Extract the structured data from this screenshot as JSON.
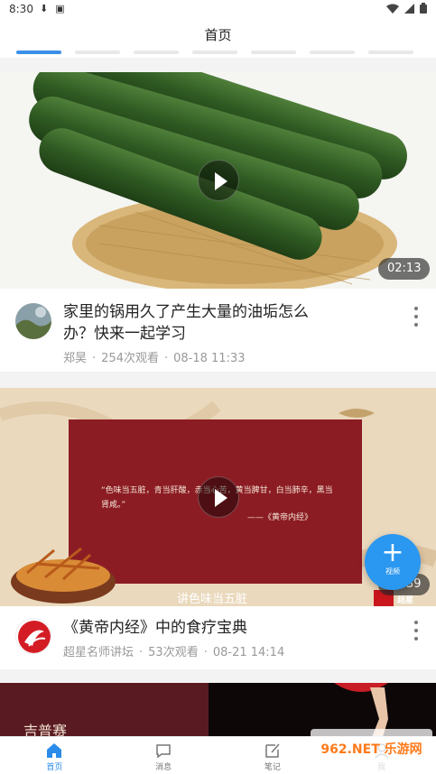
{
  "status_bar": {
    "time": "8:30"
  },
  "header": {
    "title": "首页"
  },
  "videos": [
    {
      "title": "家里的锅用久了产生大量的油垢怎么办？快来一起学习",
      "author": "郑昊",
      "views": "254次观看",
      "date": "08-18 11:33",
      "duration": "02:13"
    },
    {
      "title": "《黄帝内经》中的食疗宝典",
      "author": "超星名师讲坛",
      "views": "53次观看",
      "date": "08-21 14:14",
      "duration": "05:39",
      "quote": "“色味当五脏，青当肝酸，赤当心苦，黄当脾甘，白当肺辛，黑当肾咸。”",
      "quote_source": "——《黄帝内经》",
      "caption": "讲色味当五脏",
      "badge": "超星"
    },
    {
      "thumb_text": "吉普赛"
    }
  ],
  "fab": {
    "label": "视频"
  },
  "bottom_nav": [
    {
      "label": "首页",
      "icon": "home-icon"
    },
    {
      "label": "消息",
      "icon": "message-icon"
    },
    {
      "label": "笔记",
      "icon": "note-icon"
    },
    {
      "label": "我",
      "icon": "profile-icon"
    }
  ],
  "watermark": "962.NET 乐游网",
  "colors": {
    "accent": "#2a8bea",
    "fab": "#2a97f0",
    "meta": "#999999"
  }
}
